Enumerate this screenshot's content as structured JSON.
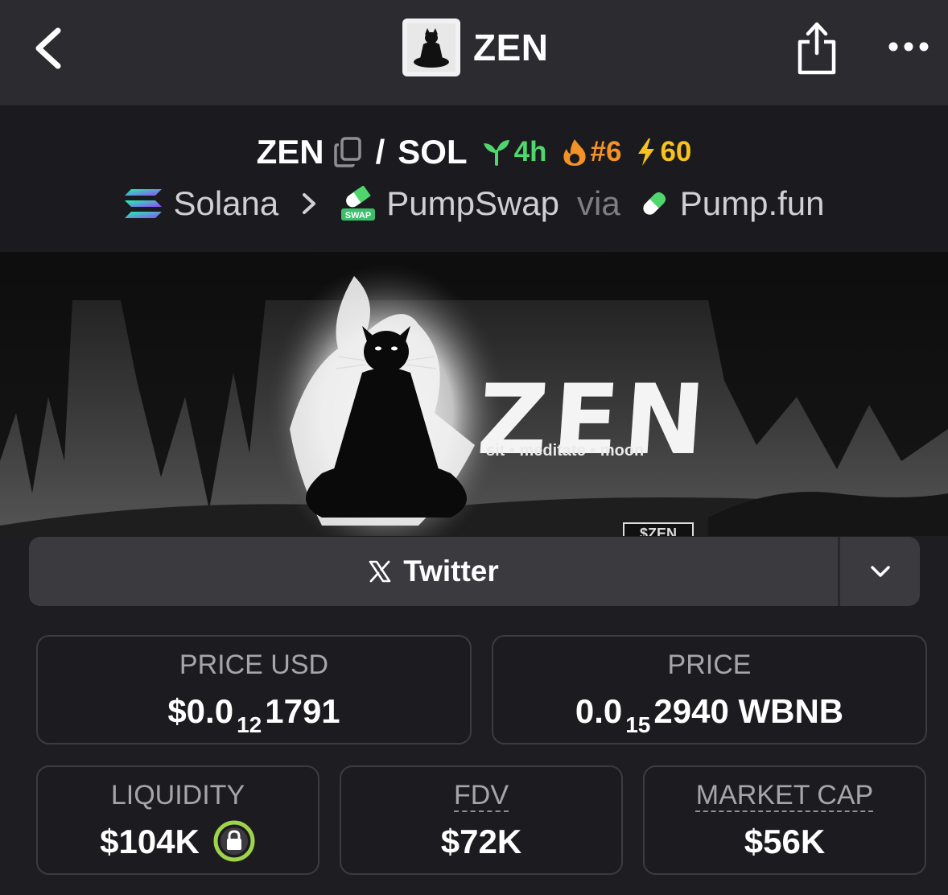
{
  "header": {
    "title": "ZEN",
    "back_icon": "chevron-left-icon",
    "share_icon": "share-icon",
    "more_icon": "more-horizontal-icon"
  },
  "pair": {
    "base": "ZEN",
    "slash": "/",
    "quote": "SOL",
    "age": "4h",
    "rank": "#6",
    "boosts": "60",
    "chain": "Solana",
    "dex": "PumpSwap",
    "via": "via",
    "launchpad": "Pump.fun"
  },
  "banner": {
    "logo_text": "ZEN",
    "tagline": "sit • meditate • moon",
    "ticker": "$ZEN"
  },
  "links": {
    "twitter_label": "Twitter"
  },
  "stats": {
    "price_usd": {
      "label": "PRICE USD",
      "prefix": "$0.0",
      "zeros": "12",
      "digits": "1791"
    },
    "price": {
      "label": "PRICE",
      "prefix": "0.0",
      "zeros": "15",
      "digits": "2940",
      "unit": "WBNB"
    },
    "liquidity": {
      "label": "LIQUIDITY",
      "value": "$104K"
    },
    "fdv": {
      "label": "FDV",
      "value": "$72K"
    },
    "market_cap": {
      "label": "MARKET CAP",
      "value": "$56K"
    }
  },
  "colors": {
    "age": "#4fd66d",
    "rank": "#f39226",
    "boost": "#f7c21d",
    "lock": "#9ed34a"
  }
}
